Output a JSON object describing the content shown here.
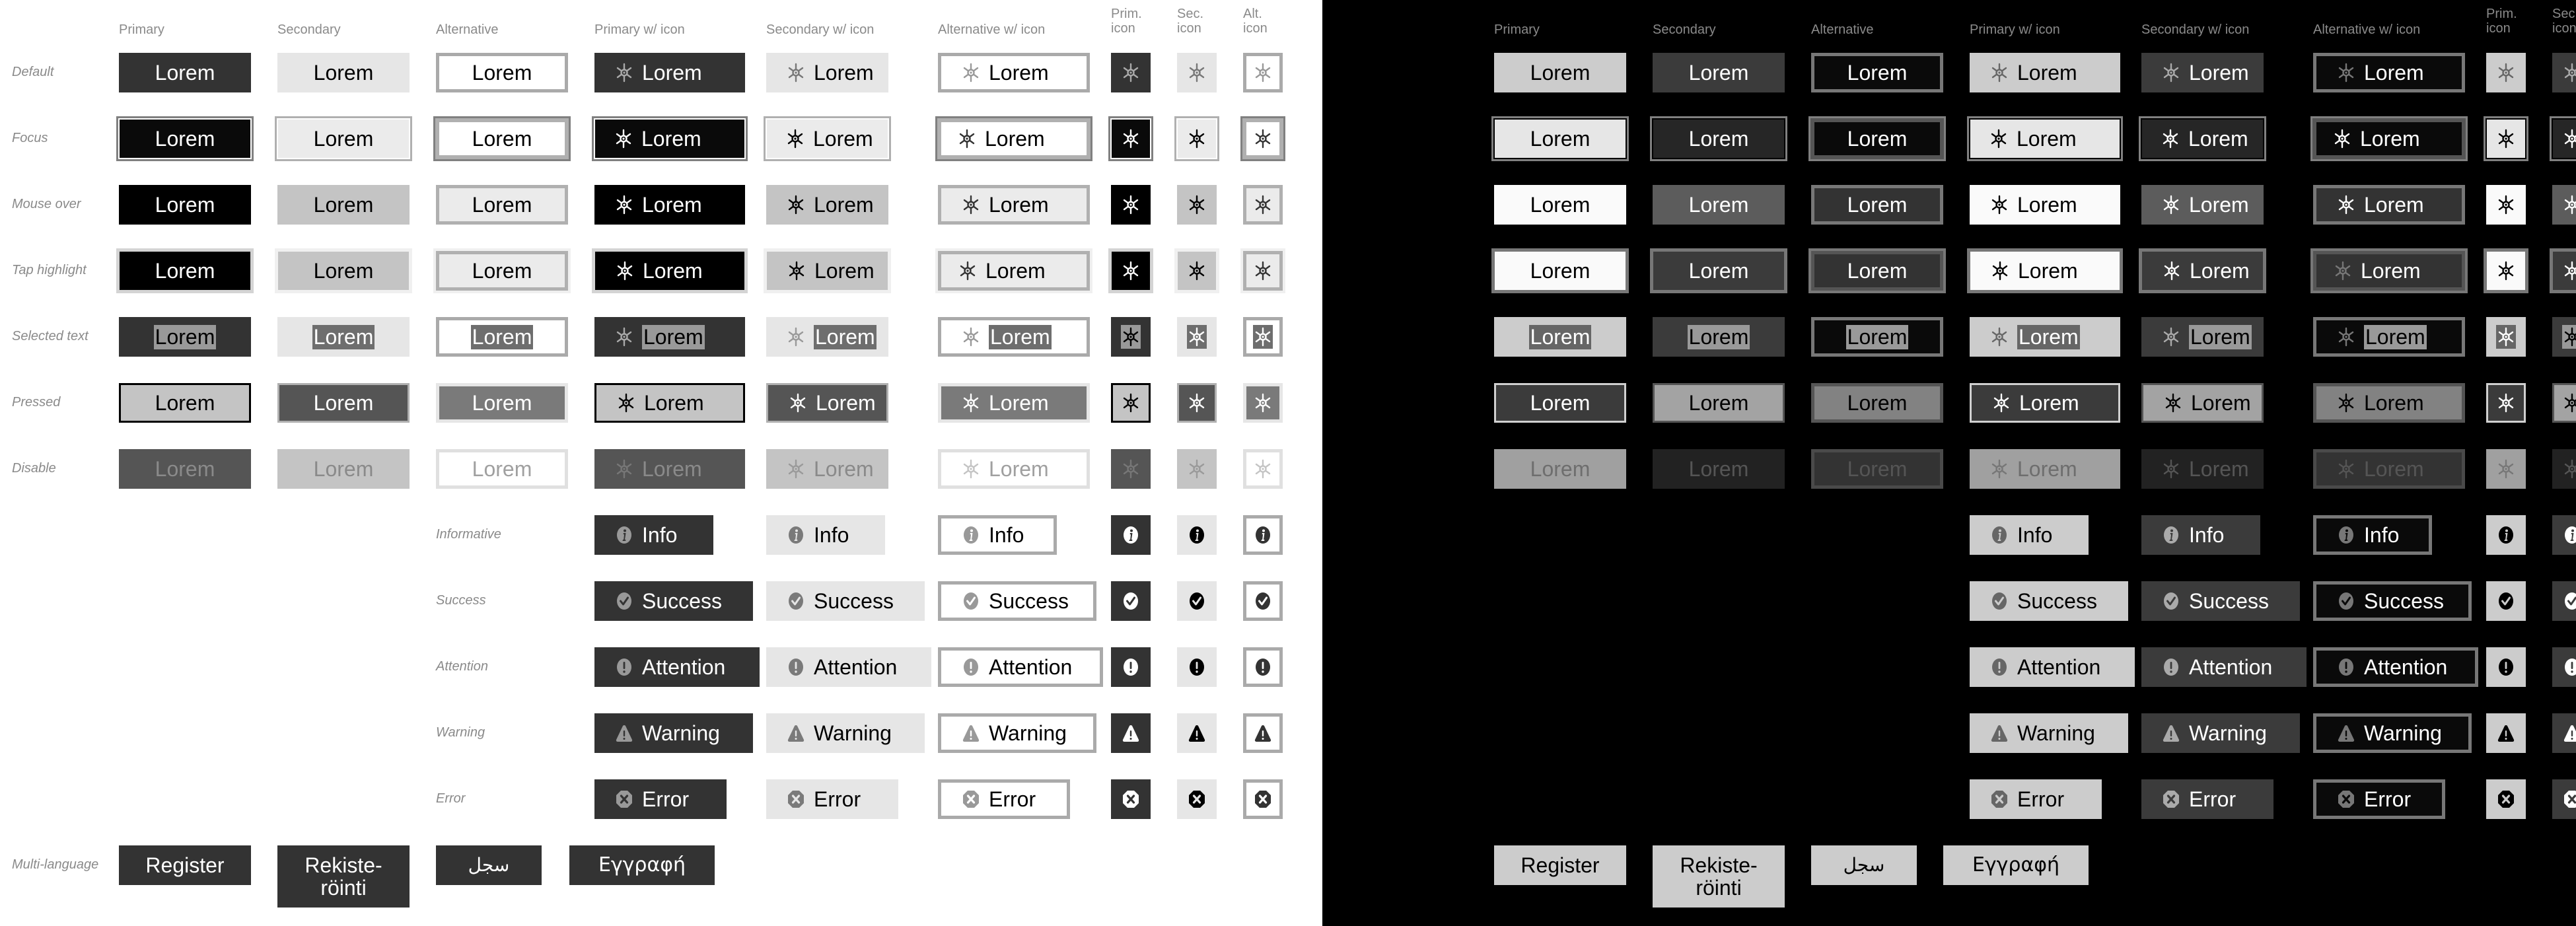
{
  "columns": {
    "primary": "Primary",
    "secondary": "Secondary",
    "alternative": "Alternative",
    "primary_icon_text": "Primary w/ icon",
    "secondary_icon_text": "Secondary w/ icon",
    "alternative_icon_text": "Alternative w/ icon",
    "prim_icon": [
      "Prim.",
      "icon"
    ],
    "sec_icon": [
      "Sec.",
      "icon"
    ],
    "alt_icon": [
      "Alt.",
      "icon"
    ]
  },
  "states": [
    "Default",
    "Focus",
    "Mouse over",
    "Tap highlight",
    "Selected text",
    "Pressed",
    "Disable"
  ],
  "button_label": "Lorem",
  "generic_icon": "asterisk-gear-icon",
  "status_rows": [
    {
      "label": "Informative",
      "text": "Info",
      "icon": "info-icon"
    },
    {
      "label": "Success",
      "text": "Success",
      "icon": "check-circle-icon"
    },
    {
      "label": "Attention",
      "text": "Attention",
      "icon": "exclamation-circle-icon"
    },
    {
      "label": "Warning",
      "text": "Warning",
      "icon": "warning-triangle-icon"
    },
    {
      "label": "Error",
      "text": "Error",
      "icon": "error-octagon-icon"
    }
  ],
  "multi_language": {
    "label": "Multi-language",
    "buttons": [
      "Register",
      "Rekiste-\nröinti",
      "سجل",
      "Εγγραφή"
    ]
  },
  "themes": {
    "light": {
      "background": "#ffffff",
      "label_color": "#8a8a8a",
      "styles": {
        "primary": [
          {
            "bg": "#333333",
            "fg": "#ffffff",
            "ic": "#aaaaaa",
            "bd": "none"
          },
          {
            "bg": "#0a0a0a",
            "fg": "#ffffff",
            "ic": "#ffffff",
            "bd": "focus",
            "ring": "#808080",
            "inner": "#ffffff"
          },
          {
            "bg": "#000000",
            "fg": "#ffffff",
            "ic": "#ffffff",
            "bd": "none"
          },
          {
            "bg": "#000000",
            "fg": "#ffffff",
            "ic": "#ffffff",
            "bd": "tap",
            "ring": "#d4d4d4"
          },
          {
            "bg": "#333333",
            "fg": "#000000",
            "ic": "#aaaaaa",
            "bd": "none",
            "selbg": "#999999"
          },
          {
            "bg": "#c4c4c4",
            "fg": "#000000",
            "ic": "#000000",
            "bd": "pressed",
            "ring": "#000000"
          },
          {
            "bg": "#555555",
            "fg": "#8a8a8a",
            "ic": "#777777",
            "bd": "none"
          }
        ],
        "secondary": [
          {
            "bg": "#e6e6e6",
            "fg": "#000000",
            "ic": "#777777",
            "bd": "none"
          },
          {
            "bg": "#ebebeb",
            "fg": "#000000",
            "ic": "#000000",
            "bd": "focus",
            "ring": "#b0b0b0",
            "inner": "#ffffff"
          },
          {
            "bg": "#c4c4c4",
            "fg": "#000000",
            "ic": "#000000",
            "bd": "none"
          },
          {
            "bg": "#c4c4c4",
            "fg": "#000000",
            "ic": "#000000",
            "bd": "tap",
            "ring": "#f0f0f0"
          },
          {
            "bg": "#e6e6e6",
            "fg": "#ffffff",
            "ic": "#999999",
            "bd": "none",
            "selbg": "#6e6e6e"
          },
          {
            "bg": "#555555",
            "fg": "#ffffff",
            "ic": "#ffffff",
            "bd": "pressed",
            "ring": "#b0b0b0"
          },
          {
            "bg": "#c4c4c4",
            "fg": "#8a8a8a",
            "ic": "#9a9a9a",
            "bd": "none"
          }
        ],
        "alternative": [
          {
            "bg": "#ffffff",
            "fg": "#000000",
            "ic": "#999999",
            "bd": "alt",
            "ring": "#aaaaaa"
          },
          {
            "bg": "#ffffff",
            "fg": "#000000",
            "ic": "#333333",
            "bd": "altfocus",
            "ring": "#b0b0b0",
            "outer": "#808080"
          },
          {
            "bg": "#ebebeb",
            "fg": "#000000",
            "ic": "#333333",
            "bd": "alt",
            "ring": "#b0b0b0"
          },
          {
            "bg": "#ebebeb",
            "fg": "#000000",
            "ic": "#333333",
            "bd": "alttap",
            "ring": "#b0b0b0",
            "outer": "#f0f0f0"
          },
          {
            "bg": "#ffffff",
            "fg": "#ffffff",
            "ic": "#999999",
            "bd": "alt",
            "ring": "#aaaaaa",
            "selbg": "#6e6e6e"
          },
          {
            "bg": "#7a7a7a",
            "fg": "#ffffff",
            "ic": "#ffffff",
            "bd": "alt",
            "ring": "#e6e6e6"
          },
          {
            "bg": "#ffffff",
            "fg": "#a0a0a0",
            "ic": "#c4c4c4",
            "bd": "alt",
            "ring": "#e0e0e0"
          }
        ]
      },
      "status": {
        "primary": {
          "bg": "#333333",
          "fg": "#ffffff",
          "ic": "#999999",
          "icon_only_ic": "#ffffff",
          "glyph": "#333333"
        },
        "secondary": {
          "bg": "#e6e6e6",
          "fg": "#000000",
          "ic": "#7a7a7a",
          "icon_only_ic": "#000000",
          "glyph": "#e6e6e6"
        },
        "alternative": {
          "bg": "#ffffff",
          "fg": "#000000",
          "ic": "#999999",
          "ring": "#aaaaaa",
          "icon_only_ic": "#333333",
          "glyph": "#ffffff"
        }
      },
      "multi": {
        "bg": "#333333",
        "fg": "#ffffff"
      }
    },
    "dark": {
      "background": "#000000",
      "label_color": "#8a8a8a",
      "styles": {
        "primary": [
          {
            "bg": "#cccccc",
            "fg": "#000000",
            "ic": "#666666",
            "bd": "none"
          },
          {
            "bg": "#e6e6e6",
            "fg": "#000000",
            "ic": "#000000",
            "bd": "focus",
            "ring": "#808080",
            "inner": "#000000"
          },
          {
            "bg": "#fafafa",
            "fg": "#000000",
            "ic": "#000000",
            "bd": "none"
          },
          {
            "bg": "#fafafa",
            "fg": "#000000",
            "ic": "#000000",
            "bd": "tap",
            "ring": "#777777"
          },
          {
            "bg": "#cccccc",
            "fg": "#ffffff",
            "ic": "#666666",
            "bd": "none",
            "selbg": "#666666"
          },
          {
            "bg": "#3b3b3b",
            "fg": "#ffffff",
            "ic": "#ffffff",
            "bd": "pressed",
            "ring": "#d0d0d0"
          },
          {
            "bg": "#a0a0a0",
            "fg": "#6e6e6e",
            "ic": "#777777",
            "bd": "none"
          }
        ],
        "secondary": [
          {
            "bg": "#3b3b3b",
            "fg": "#ffffff",
            "ic": "#aaaaaa",
            "bd": "none"
          },
          {
            "bg": "#262626",
            "fg": "#ffffff",
            "ic": "#ffffff",
            "bd": "focus",
            "ring": "#808080",
            "inner": "#000000"
          },
          {
            "bg": "#5c5c5c",
            "fg": "#ffffff",
            "ic": "#ffffff",
            "bd": "none"
          },
          {
            "bg": "#3b3b3b",
            "fg": "#ffffff",
            "ic": "#ffffff",
            "bd": "tap",
            "ring": "#777777"
          },
          {
            "bg": "#3b3b3b",
            "fg": "#000000",
            "ic": "#aaaaaa",
            "bd": "none",
            "selbg": "#999999"
          },
          {
            "bg": "#a3a3a3",
            "fg": "#000000",
            "ic": "#000000",
            "bd": "pressed",
            "ring": "#555555"
          },
          {
            "bg": "#222222",
            "fg": "#555555",
            "ic": "#555555",
            "bd": "none"
          }
        ],
        "alternative": [
          {
            "bg": "#0a0a0a",
            "fg": "#ffffff",
            "ic": "#777777",
            "bd": "alt",
            "ring": "#777777"
          },
          {
            "bg": "#0a0a0a",
            "fg": "#ffffff",
            "ic": "#ffffff",
            "bd": "altfocus",
            "ring": "#555555",
            "outer": "#808080"
          },
          {
            "bg": "#333333",
            "fg": "#ffffff",
            "ic": "#ffffff",
            "bd": "alt",
            "ring": "#777777"
          },
          {
            "bg": "#333333",
            "fg": "#ffffff",
            "ic": "#777777",
            "bd": "alttap",
            "ring": "#555555",
            "outer": "#777777"
          },
          {
            "bg": "#0a0a0a",
            "fg": "#000000",
            "ic": "#777777",
            "bd": "alt",
            "ring": "#777777",
            "selbg": "#999999"
          },
          {
            "bg": "#828282",
            "fg": "#000000",
            "ic": "#000000",
            "bd": "alt",
            "ring": "#555555"
          },
          {
            "bg": "#333333",
            "fg": "#555555",
            "ic": "#555555",
            "bd": "alt",
            "ring": "#4a4a4a"
          }
        ]
      },
      "status": {
        "primary": {
          "bg": "#cccccc",
          "fg": "#000000",
          "ic": "#666666",
          "icon_only_ic": "#000000",
          "glyph": "#cccccc"
        },
        "secondary": {
          "bg": "#3b3b3b",
          "fg": "#ffffff",
          "ic": "#aaaaaa",
          "icon_only_ic": "#ffffff",
          "glyph": "#3b3b3b"
        },
        "alternative": {
          "bg": "#0a0a0a",
          "fg": "#ffffff",
          "ic": "#777777",
          "ring": "#777777",
          "icon_only_ic": "#ffffff",
          "glyph": "#0a0a0a"
        }
      },
      "multi": {
        "bg": "#cccccc",
        "fg": "#000000"
      }
    }
  }
}
